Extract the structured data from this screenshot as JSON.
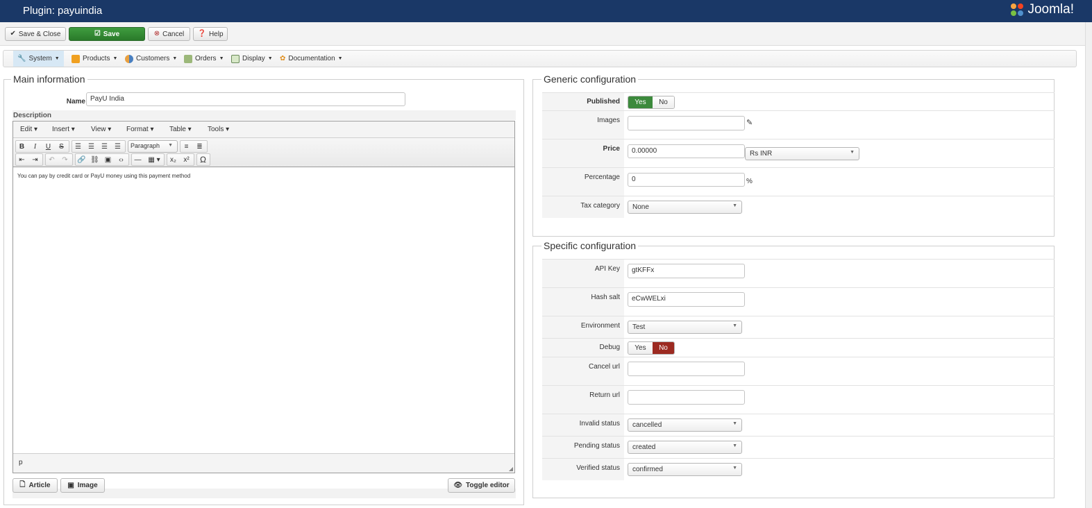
{
  "header": {
    "title": "Plugin: payuindia",
    "logo_text": "Joomla!"
  },
  "toolbar": {
    "save_close": "Save & Close",
    "save": "Save",
    "cancel": "Cancel",
    "help": "Help"
  },
  "menu": [
    {
      "label": "System",
      "icon": "wrench-icon"
    },
    {
      "label": "Products",
      "icon": "box-icon"
    },
    {
      "label": "Customers",
      "icon": "users-icon"
    },
    {
      "label": "Orders",
      "icon": "cart-icon"
    },
    {
      "label": "Display",
      "icon": "display-icon"
    },
    {
      "label": "Documentation",
      "icon": "help-icon"
    }
  ],
  "main": {
    "legend": "Main information",
    "name_label": "Name",
    "name_value": "PayU India",
    "description_label": "Description",
    "editor": {
      "menus": [
        "Edit",
        "Insert",
        "View",
        "Format",
        "Table",
        "Tools"
      ],
      "format_select": "Paragraph",
      "content": "You can pay by credit card or PayU money using this payment method",
      "status_path": "p"
    },
    "buttons": {
      "article": "Article",
      "image": "Image",
      "toggle": "Toggle editor"
    }
  },
  "generic": {
    "legend": "Generic configuration",
    "published_label": "Published",
    "published_yes": "Yes",
    "published_no": "No",
    "images_label": "Images",
    "images_value": "",
    "price_label": "Price",
    "price_value": "0.00000",
    "currency": "Rs INR",
    "percentage_label": "Percentage",
    "percentage_value": "0",
    "percent_sign": "%",
    "tax_label": "Tax category",
    "tax_value": "None"
  },
  "specific": {
    "legend": "Specific configuration",
    "api_key_label": "API Key",
    "api_key_value": "gtKFFx",
    "hash_salt_label": "Hash salt",
    "hash_salt_value": "eCwWELxi",
    "environment_label": "Environment",
    "environment_value": "Test",
    "debug_label": "Debug",
    "debug_yes": "Yes",
    "debug_no": "No",
    "cancel_url_label": "Cancel url",
    "cancel_url_value": "",
    "return_url_label": "Return url",
    "return_url_value": "",
    "invalid_status_label": "Invalid status",
    "invalid_status_value": "cancelled",
    "pending_status_label": "Pending status",
    "pending_status_value": "created",
    "verified_status_label": "Verified status",
    "verified_status_value": "confirmed"
  },
  "colors": {
    "header_bg": "#1a3867",
    "save_green": "#3c8a3c",
    "debug_no_red": "#9c2a21"
  }
}
